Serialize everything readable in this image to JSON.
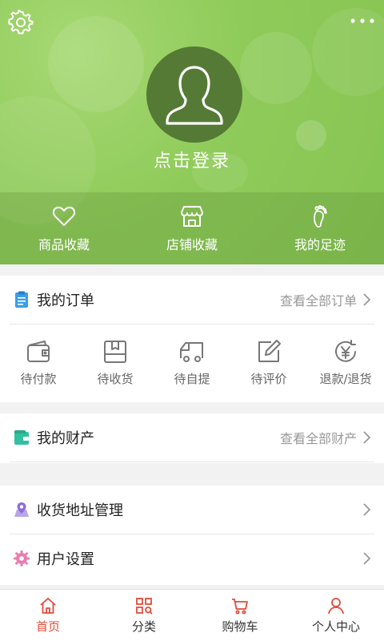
{
  "header": {
    "settings_icon": "gear-icon",
    "more_icon": "more-dots-icon",
    "avatar_icon": "user-silhouette-icon",
    "login_text": "点击登录",
    "quick_links": [
      {
        "label": "商品收藏",
        "icon": "heart-icon"
      },
      {
        "label": "店铺收藏",
        "icon": "store-icon"
      },
      {
        "label": "我的足迹",
        "icon": "footprint-icon"
      }
    ]
  },
  "orders": {
    "title": "我的订单",
    "link": "查看全部订单",
    "items": [
      {
        "label": "待付款",
        "icon": "wallet-icon"
      },
      {
        "label": "待收货",
        "icon": "package-icon"
      },
      {
        "label": "待自提",
        "icon": "truck-icon"
      },
      {
        "label": "待评价",
        "icon": "edit-icon"
      },
      {
        "label": "退款/退货",
        "icon": "refund-icon"
      }
    ]
  },
  "assets": {
    "title": "我的财产",
    "link": "查看全部财产"
  },
  "menu": [
    {
      "label": "收货地址管理",
      "icon": "map-pin-icon"
    },
    {
      "label": "用户设置",
      "icon": "gear-icon"
    }
  ],
  "tabbar": [
    {
      "label": "首页",
      "icon": "home-icon",
      "active": true
    },
    {
      "label": "分类",
      "icon": "grid-icon",
      "active": false
    },
    {
      "label": "购物车",
      "icon": "cart-icon",
      "active": false
    },
    {
      "label": "个人中心",
      "icon": "person-icon",
      "active": false
    }
  ],
  "colors": {
    "header_green": "#8fcb5a",
    "active_red": "#e24b3b",
    "order_icon_blue": "#3b9ee8",
    "assets_icon_teal": "#33c0a0"
  }
}
